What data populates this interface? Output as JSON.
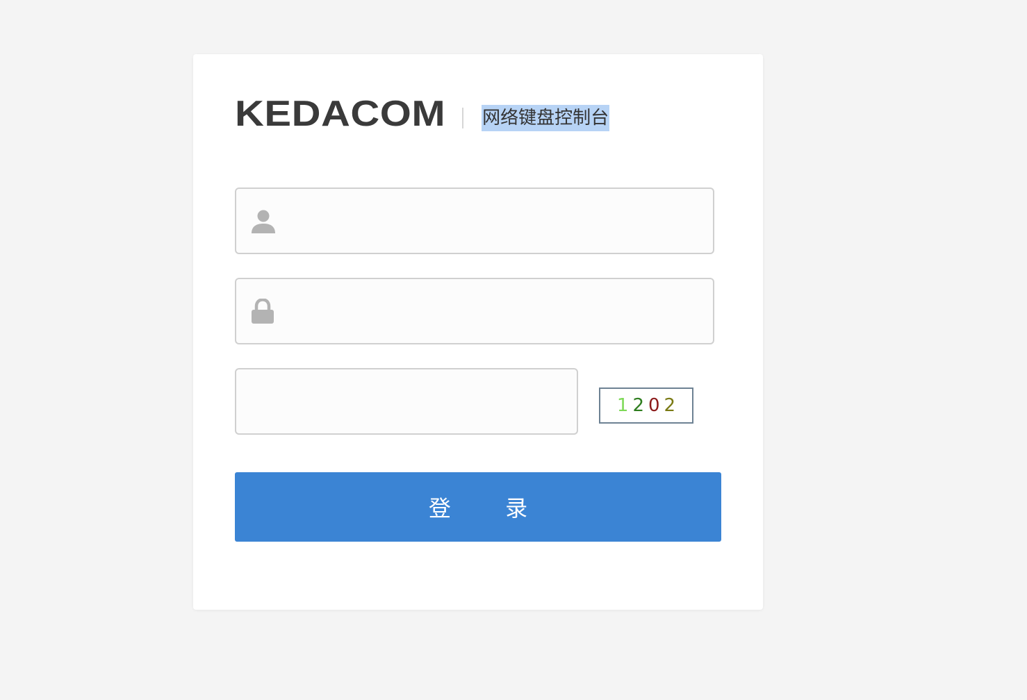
{
  "brand": {
    "logo_text": "KEDACOM",
    "subtitle": "网络键盘控制台"
  },
  "form": {
    "username": {
      "icon": "user-icon",
      "value": "",
      "placeholder": ""
    },
    "password": {
      "icon": "lock-icon",
      "value": "",
      "placeholder": ""
    },
    "captcha": {
      "value": "",
      "placeholder": "",
      "digits": [
        {
          "char": "1",
          "color": "#7ed957"
        },
        {
          "char": "2",
          "color": "#2e7d1e"
        },
        {
          "char": "0",
          "color": "#8b1a1a"
        },
        {
          "char": "2",
          "color": "#7a7a14"
        }
      ]
    },
    "login_button_label": "登 录"
  },
  "colors": {
    "background": "#f4f4f4",
    "card": "#ffffff",
    "accent": "#3b84d4",
    "icon_gray": "#b3b3b3",
    "subtitle_highlight": "#b7d3f5"
  }
}
